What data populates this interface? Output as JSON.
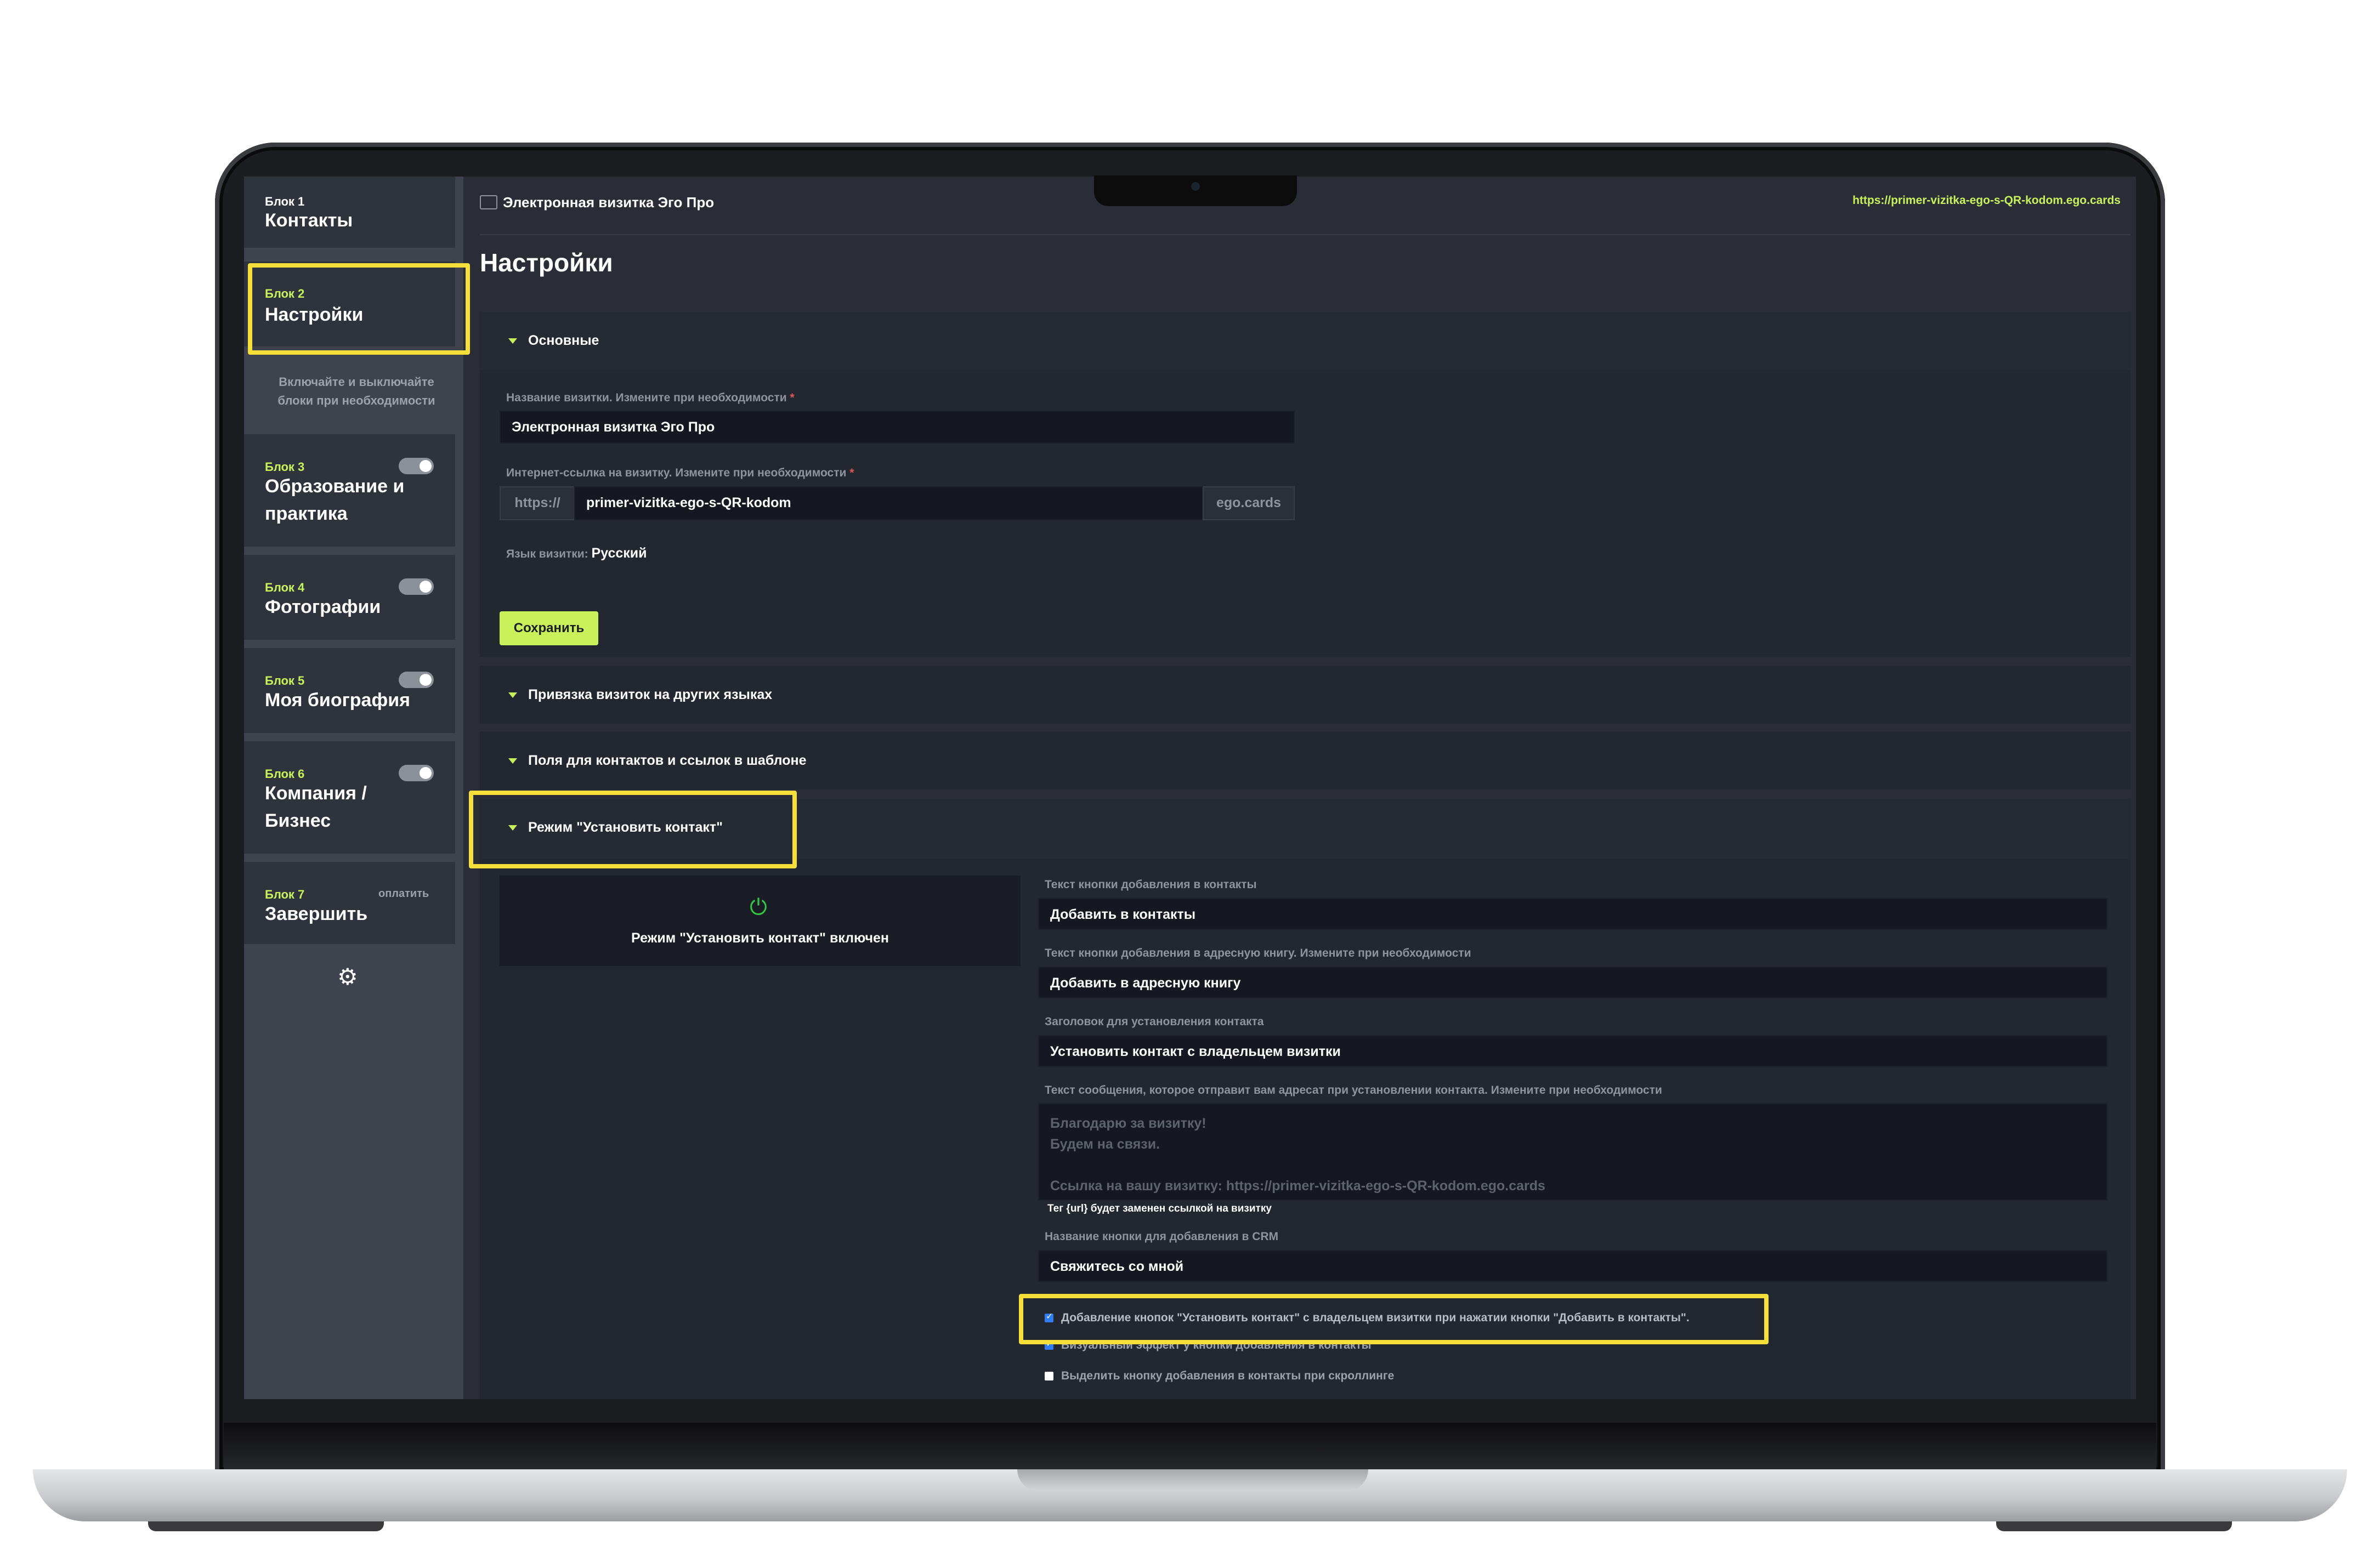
{
  "app": {
    "title": "Электронная визитка Эго Про",
    "card_url": "https://primer-vizitka-ego-s-QR-kodom.ego.cards",
    "page_title": "Настройки"
  },
  "sidebar": {
    "hint": "Включайте и выключайте блоки при необходимости",
    "items": [
      {
        "num": "Блок 1",
        "title": "Контакты"
      },
      {
        "num": "Блок 2",
        "title": "Настройки"
      },
      {
        "num": "Блок 3",
        "title": "Образование и практика"
      },
      {
        "num": "Блок 4",
        "title": "Фотографии"
      },
      {
        "num": "Блок 5",
        "title": "Моя биография"
      },
      {
        "num": "Блок 6",
        "title": "Компания / Бизнес"
      },
      {
        "num": "Блок 7",
        "title": "Завершить",
        "badge": "оплатить"
      }
    ]
  },
  "sections": {
    "basic": {
      "title": "Основные",
      "name_label": "Название визитки. Измените при необходимости",
      "name_value": "Электронная визитка Эго Про",
      "url_label": "Интернет-ссылка на визитку. Измените при необходимости",
      "url_prefix": "https://",
      "url_value": "primer-vizitka-ego-s-QR-kodom",
      "url_suffix": "ego.cards",
      "lang_label": "Язык визитки:",
      "lang_value": "Русский",
      "save_label": "Сохранить"
    },
    "linking_title": "Привязка визиток на других языках",
    "fields_title": "Поля для контактов и ссылок в шаблоне",
    "contact_mode": {
      "title": "Режим \"Установить контакт\"",
      "status": "Режим \"Установить контакт\" включен",
      "add_btn_label": "Текст кнопки добавления в контакты",
      "add_btn_value": "Добавить в контакты",
      "addr_btn_label": "Текст кнопки добавления в адресную книгу. Измените при необходимости",
      "addr_btn_value": "Добавить в адресную книгу",
      "header_label": "Заголовок для установления контакта",
      "header_value": "Установить контакт с владельцем визитки",
      "msg_label": "Текст сообщения, которое отправит вам адресат при установлении контакта. Измените при необходимости",
      "msg_placeholder": "Благодарю за визитку!\nБудем на связи.\n\nСсылка на вашу визитку: https://primer-vizitka-ego-s-QR-kodom.ego.cards",
      "msg_hint": "Тег {url} будет заменен ссылкой на визитку",
      "crm_label": "Название кнопки для добавления в CRM",
      "crm_value": "Свяжитесь со мной",
      "checkboxes": [
        {
          "label": "Добавление кнопок \"Установить контакт\" с владельцем визитки при нажатии кнопки \"Добавить в контакты\".",
          "checked": true
        },
        {
          "label": "Визуальный эффект у кнопки добавления в контакты",
          "checked": true
        },
        {
          "label": "Выделить кнопку добавления в контакты при скроллинге",
          "checked": false
        }
      ]
    }
  },
  "colors": {
    "accent": "#c9f25a",
    "highlight": "#f7df3a",
    "power": "#2ecc40"
  }
}
